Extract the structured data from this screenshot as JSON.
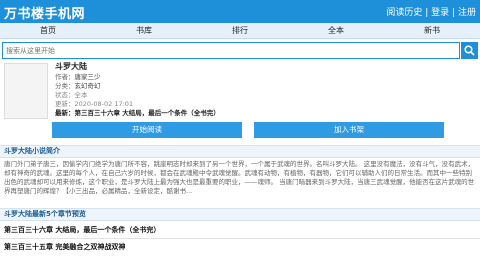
{
  "header": {
    "logo": "万书楼手机网",
    "links": [
      "阅读历史",
      "登录",
      "注册"
    ],
    "sep": "|"
  },
  "nav": [
    "首页",
    "书库",
    "排行",
    "全本",
    "新书"
  ],
  "search": {
    "placeholder": "搜索从这里开始"
  },
  "book": {
    "title": "斗罗大陆",
    "author_label": "作者：",
    "author": "唐家三少",
    "category_label": "分类：",
    "category": "玄幻奇幻",
    "status_label": "状态：",
    "status": "全本",
    "updated_label": "更新：",
    "updated": "2020-08-02 17:01",
    "latest_label": "最新：",
    "latest": "第三百三十六章 大结局，最后一个条件（全书完）"
  },
  "buttons": {
    "read": "开始阅读",
    "shelf": "加入书架"
  },
  "intro": {
    "heading": "斗罗大陆小说简介",
    "text": "唐门外门弟子唐三，因偷学内门绝学为唐门所不容，跳崖明志时却来到了另一个世界，一个属于武魂的世界。名叫斗罗大陆。 这里没有魔法，没有斗气，没有武术，却有神奇的武魂。这里的每个人，在自己六岁的时候，都会在武魂殿中令武魂觉醒。武魂有动物，有植物，有器物，它们可以辅助人们的日常生活。而其中一些特别出色的武魂却可以用来修炼，这个职业，是斗罗大陆上最为强大也是最重要的职业，——魂师。 当唐门暗器来到斗罗大陆，当唐三武魂觉醒，他能否在这片武魂的世界再塑唐门的辉煌？【小三出品，必属精品，全新设定，酷谢书..."
  },
  "chapters": {
    "heading": "斗罗大陆最新5个章节预览",
    "items": [
      "第三百三十六章 大结局，最后一个条件（全书完）",
      "第三百三十五章 完美融合之双神战双神"
    ]
  }
}
